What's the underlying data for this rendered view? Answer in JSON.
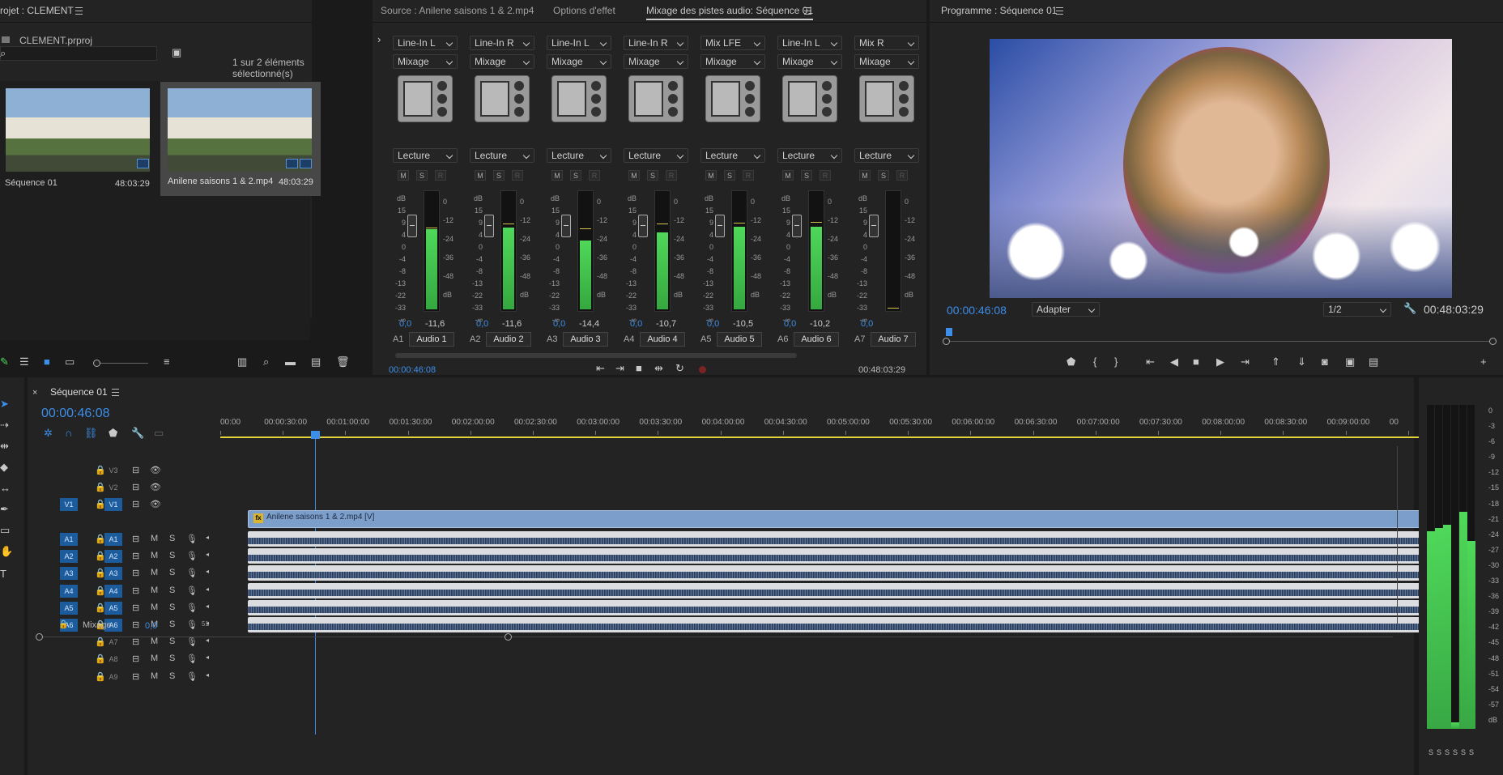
{
  "project": {
    "title": "rojet : CLEMENT",
    "file": "CLEMENT.prproj",
    "selection_info": "1 sur 2 éléments sélectionné(s)",
    "items": [
      {
        "name": "Séquence 01",
        "duration": "48:03:29"
      },
      {
        "name": "Anilene saisons 1 & 2.mp4",
        "duration": "48:03:29"
      }
    ]
  },
  "mixer": {
    "tabs": [
      "Source : Anilene saisons 1 & 2.mp4",
      "Options d'effet",
      "Mixage des pistes audio: Séquence 01"
    ],
    "channels": [
      {
        "input": "Line-In L",
        "mode": "Mixage",
        "auto": "Lecture",
        "val": "0,0",
        "db": "-11,6",
        "track": "A1",
        "name": "Audio 1",
        "level": 0.68,
        "peak": 0.7
      },
      {
        "input": "Line-In R",
        "mode": "Mixage",
        "auto": "Lecture",
        "val": "0,0",
        "db": "-11,6",
        "track": "A2",
        "name": "Audio 2",
        "level": 0.69,
        "peak": 0.73
      },
      {
        "input": "Line-In L",
        "mode": "Mixage",
        "auto": "Lecture",
        "val": "0,0",
        "db": "-14,4",
        "track": "A3",
        "name": "Audio 3",
        "level": 0.58,
        "peak": 0.69
      },
      {
        "input": "Line-In R",
        "mode": "Mixage",
        "auto": "Lecture",
        "val": "0,0",
        "db": "-10,7",
        "track": "A4",
        "name": "Audio 4",
        "level": 0.65,
        "peak": 0.73
      },
      {
        "input": "Mix LFE",
        "mode": "Mixage",
        "auto": "Lecture",
        "val": "0,0",
        "db": "-10,5",
        "track": "A5",
        "name": "Audio 5",
        "level": 0.7,
        "peak": 0.74
      },
      {
        "input": "Line-In L",
        "mode": "Mixage",
        "auto": "Lecture",
        "val": "0,0",
        "db": "-10,2",
        "track": "A6",
        "name": "Audio 6",
        "level": 0.7,
        "peak": 0.75
      },
      {
        "input": "Mix R",
        "mode": "Mixage",
        "auto": "Lecture",
        "val": "0,0",
        "db": "",
        "track": "A7",
        "name": "Audio 7",
        "level": 0,
        "peak": 0.02
      }
    ],
    "scale_left": [
      "dB",
      "15",
      "9",
      "4",
      "0",
      "-4",
      "-8",
      "-13",
      "-22",
      "-33",
      "-∞"
    ],
    "scale_right": [
      "0",
      "-12",
      "-24",
      "-36",
      "-48",
      "dB"
    ],
    "btn_labels": [
      "M",
      "S",
      "R"
    ],
    "timecode": "00:00:46:08",
    "duration": "00:48:03:29"
  },
  "program": {
    "title": "Programme : Séquence 01",
    "timecode": "00:00:46:08",
    "fit": "Adapter",
    "quality": "1/2",
    "duration": "00:48:03:29"
  },
  "timeline": {
    "title": "Séquence 01",
    "timecode": "00:00:46:08",
    "ruler": [
      "00:00",
      "00:00:30:00",
      "00:01:00:00",
      "00:01:30:00",
      "00:02:00:00",
      "00:02:30:00",
      "00:03:00:00",
      "00:03:30:00",
      "00:04:00:00",
      "00:04:30:00",
      "00:05:00:00",
      "00:05:30:00",
      "00:06:00:00",
      "00:06:30:00",
      "00:07:00:00",
      "00:07:30:00",
      "00:08:00:00",
      "00:08:30:00",
      "00:09:00:00",
      "00"
    ],
    "video_tracks": [
      "V3",
      "V2",
      "V1"
    ],
    "video_src": "V1",
    "audio_tracks": [
      "A1",
      "A2",
      "A3",
      "A4",
      "A5",
      "A6",
      "A7",
      "A8",
      "A9"
    ],
    "video_clip": "Anilene saisons 1 & 2.mp4 [V]",
    "fx": "fx",
    "mix_label": "Mixage",
    "mix_value": "0,0",
    "mix_extra": "51",
    "m": "M",
    "s": "S"
  },
  "master_meter": {
    "scale": [
      "0",
      "-3",
      "-6",
      "-9",
      "-12",
      "-15",
      "-18",
      "-21",
      "-24",
      "-27",
      "-30",
      "-33",
      "-36",
      "-39",
      "-42",
      "-45",
      "-48",
      "-51",
      "-54",
      "-57",
      "dB"
    ],
    "levels": [
      0.61,
      0.62,
      0.63,
      0.02,
      0.67,
      0.58
    ],
    "solo": [
      "S",
      "S",
      "S",
      "S",
      "S",
      "S"
    ]
  },
  "colors": {
    "accent": "#3d8ee8",
    "meter": "#4fd85a",
    "clip_video": "#7c9ecb",
    "track_on": "#1c5c9c"
  }
}
